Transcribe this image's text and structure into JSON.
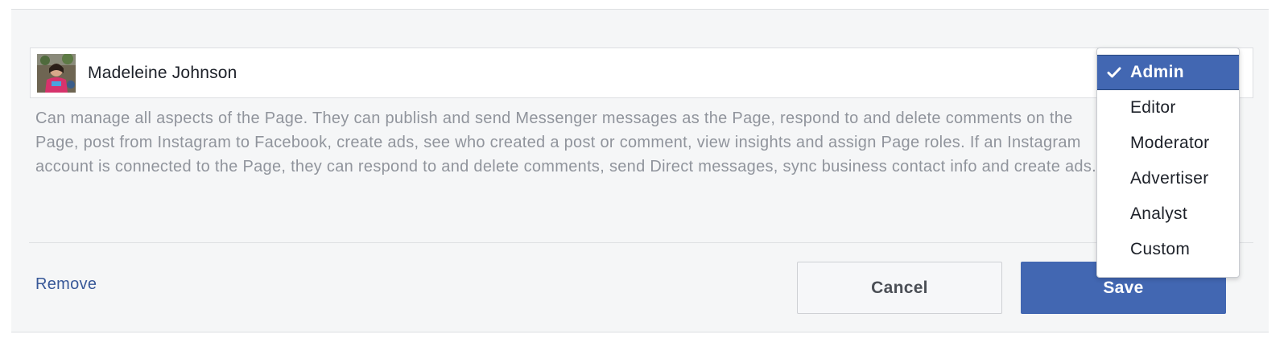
{
  "user": {
    "name": "Madeleine Johnson"
  },
  "role_description": "Can manage all aspects of the Page. They can publish and send Messenger messages as the Page, respond to and delete comments on the Page, post from Instagram to Facebook, create ads, see who created a post or comment, view insights and assign Page roles. If an Instagram account is connected to the Page, they can respond to and delete comments, send Direct messages, sync business contact info and create ads.",
  "actions": {
    "remove_label": "Remove",
    "cancel_label": "Cancel",
    "save_label": "Save"
  },
  "role_menu": {
    "selected": "Admin",
    "options": [
      "Admin",
      "Editor",
      "Moderator",
      "Advertiser",
      "Analyst",
      "Custom"
    ]
  },
  "colors": {
    "accent": "#4267b2",
    "link": "#385898",
    "panel_bg": "#f5f6f7",
    "muted_text": "#90949c"
  },
  "icons": {
    "selected_marker": "check-icon"
  }
}
